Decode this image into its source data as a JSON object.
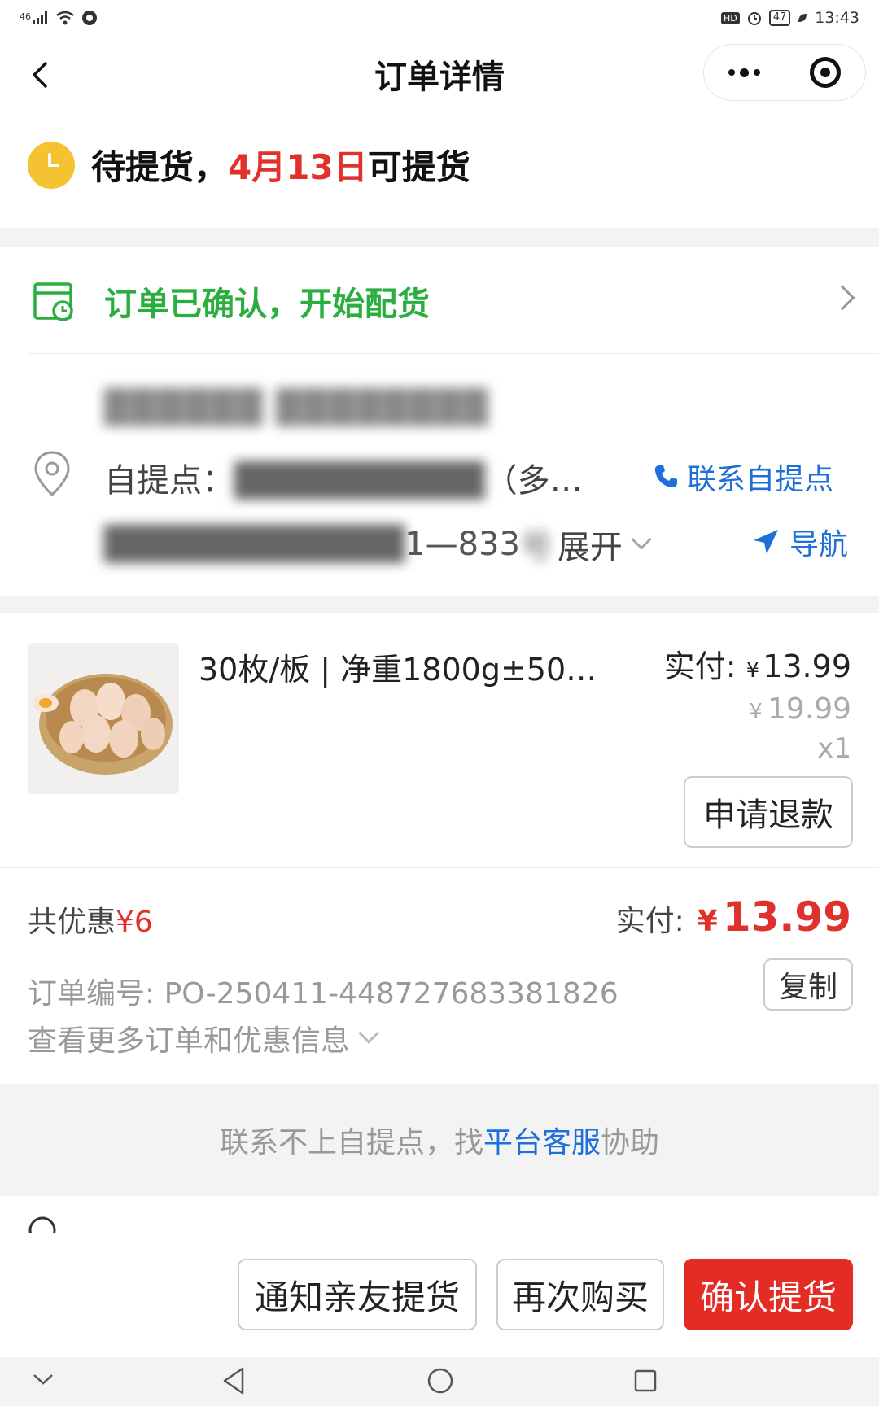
{
  "status_bar": {
    "network": "46",
    "hd": "HD",
    "battery": "47",
    "time": "13:43"
  },
  "header": {
    "title": "订单详情"
  },
  "order_status": {
    "prefix": "待提货，",
    "date": "4月13日",
    "suffix": "可提货"
  },
  "confirmation": {
    "text": "订单已确认，开始配货"
  },
  "pickup": {
    "label": "自提点：",
    "ellipsis_suffix": "（多…",
    "contact_label": "联系自提点",
    "addr_visible": "1—833",
    "addr_tail": "号",
    "expand_label": "展开",
    "navigate_label": "导航"
  },
  "product": {
    "title": "30枚/板 | 净重1800g±50…",
    "paid_label": "实付:",
    "currency": "¥",
    "paid_price": "13.99",
    "original_price": "19.99",
    "quantity": "x1",
    "refund_label": "申请退款"
  },
  "summary": {
    "discount_label": "共优惠",
    "discount_amount": "¥6",
    "paid_label": "实付:",
    "paid_total": "13.99",
    "order_no_label": "订单编号:",
    "order_no": "PO-250411-448727683381826",
    "copy_label": "复制",
    "more_info_label": "查看更多订单和优惠信息"
  },
  "help": {
    "prefix": "联系不上自提点，找",
    "link": "平台客服",
    "suffix": "协助"
  },
  "actions": {
    "notify_friends": "通知亲友提货",
    "buy_again": "再次购买",
    "confirm_pickup": "确认提货"
  },
  "colors": {
    "accent_red": "#e42b24",
    "success_green": "#2aae3f",
    "link_blue": "#1f6fd8",
    "status_yellow": "#f5c231"
  }
}
